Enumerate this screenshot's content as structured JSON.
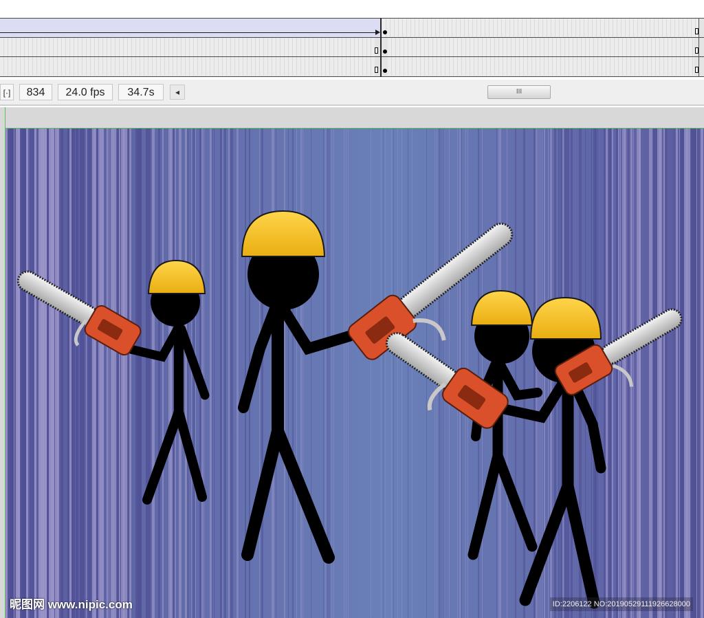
{
  "timeline": {
    "tracks": [
      {
        "type": "motion-tween"
      },
      {
        "type": "static"
      },
      {
        "type": "static"
      }
    ]
  },
  "statusbar": {
    "center_icon": "center-frame-icon",
    "current_frame": "834",
    "frame_rate": "24.0 fps",
    "elapsed_time": "34.7s",
    "scroll_left_icon": "◂",
    "scroll_thumb_grip": "III"
  },
  "stage": {
    "background_colors": {
      "center": "#6a7fb8",
      "stripe_dark": "#4f4f95",
      "stripe_light": "#9a94c8"
    },
    "helmet_color": "#f5c021",
    "chainsaw_body_color": "#d9502a",
    "stick_figure_count": 4
  },
  "watermark": {
    "site_text": "昵图网 www.nipic.com",
    "id_text": "ID:2206122 NO:20190529111926628000"
  }
}
